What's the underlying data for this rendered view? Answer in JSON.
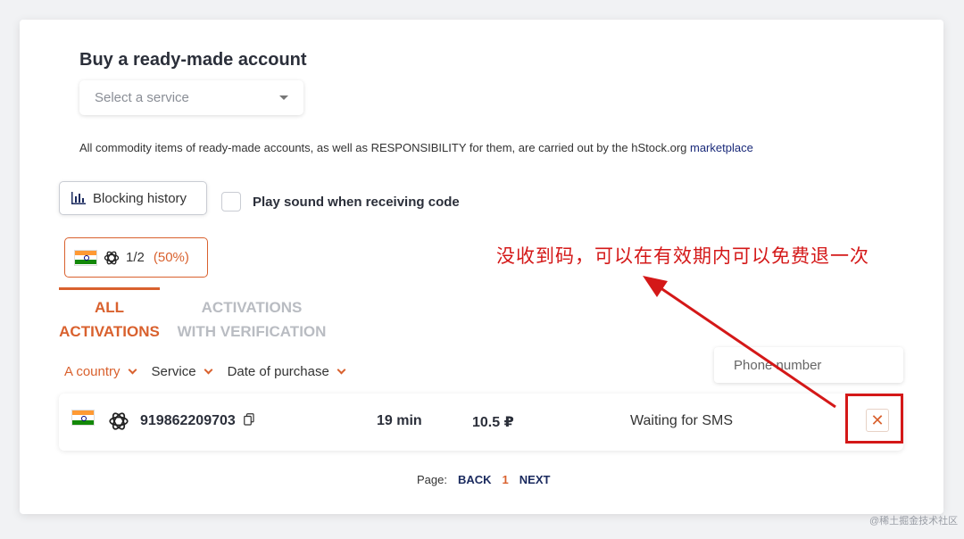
{
  "header": {
    "title": "Buy a ready-made account"
  },
  "service_select": {
    "placeholder": "Select a service"
  },
  "disclaimer": {
    "text": "All commodity items of ready-made accounts, as well as RESPONSIBILITY for them, are carried out by the hStock.org ",
    "link": "marketplace"
  },
  "toolbar": {
    "blocking_history_label": "Blocking history",
    "play_sound_label": "Play sound when receiving code",
    "play_sound_checked": false
  },
  "stats_chip": {
    "ratio": "1/2",
    "percent": "(50%)"
  },
  "tabs": [
    {
      "label_line1": "ALL",
      "label_line2": "ACTIVATIONS",
      "active": true
    },
    {
      "label_line1": "ACTIVATIONS",
      "label_line2": "WITH VERIFICATION",
      "active": false
    }
  ],
  "filters": [
    {
      "label": "A country",
      "active": true
    },
    {
      "label": "Service",
      "active": false
    },
    {
      "label": "Date of purchase",
      "active": false
    }
  ],
  "phone_search": {
    "placeholder": "Phone number"
  },
  "activations": [
    {
      "country": "India",
      "service_icon": "openai-icon",
      "phone": "919862209703",
      "duration": "19 min",
      "price": "10.5 ₽",
      "status": "Waiting for SMS"
    }
  ],
  "pagination": {
    "label": "Page:",
    "back": "BACK",
    "current": "1",
    "next": "NEXT"
  },
  "annotation": {
    "text": "没收到码，可以在有效期内可以免费退一次"
  },
  "watermark": {
    "text": "@稀土掘金技术社区"
  },
  "colors": {
    "accent": "#d9612e",
    "annotation": "#d41818",
    "link": "#1a2a5e"
  }
}
